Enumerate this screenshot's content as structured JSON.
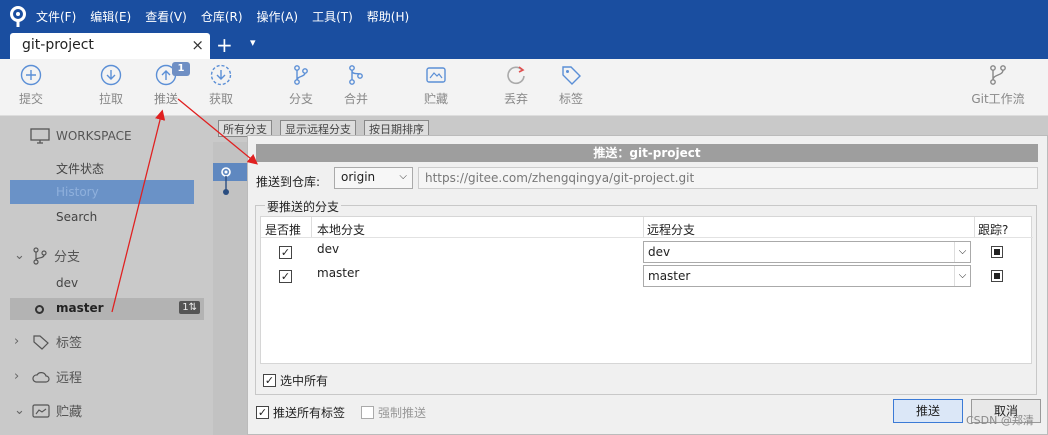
{
  "menu": {
    "items": [
      "文件(F)",
      "编辑(E)",
      "查看(V)",
      "仓库(R)",
      "操作(A)",
      "工具(T)",
      "帮助(H)"
    ]
  },
  "tabs": {
    "active": "git-project",
    "close": "×",
    "add": "+",
    "more": "▾"
  },
  "toolbar": {
    "commit": "提交",
    "pull": "拉取",
    "push": "推送",
    "fetch": "获取",
    "branch": "分支",
    "merge": "合并",
    "stash": "贮藏",
    "discard": "丢弃",
    "tag": "标签",
    "gitflow": "Git工作流",
    "push_badge": "1"
  },
  "sidebar": {
    "workspace": "WORKSPACE",
    "file_status": "文件状态",
    "history": "History",
    "search": "Search",
    "branches": "分支",
    "branch_dev": "dev",
    "branch_master": "master",
    "master_count": "1⇅",
    "tags": "标签",
    "remotes": "远程",
    "stashes": "贮藏"
  },
  "filterbar": {
    "all_branches": "所有分支",
    "show_remote": "显示远程分支",
    "sort": "按日期排序"
  },
  "dialog": {
    "title": "推送：git-project",
    "push_to_repo_label": "推送到仓库:",
    "repo_value": "origin",
    "repo_url": "https://gitee.com/zhengqingya/git-project.git",
    "branches_group": "要推送的分支",
    "columns": [
      "是否推",
      "本地分支",
      "远程分支",
      "跟踪?"
    ],
    "rows": [
      {
        "local": "dev",
        "remote": "dev",
        "push": true,
        "track": true
      },
      {
        "local": "master",
        "remote": "master",
        "push": true,
        "track": true
      }
    ],
    "select_all": "选中所有",
    "push_all_tags": "推送所有标签",
    "force_push": "强制推送",
    "push_button": "推送",
    "cancel_button": "取消"
  },
  "watermark": "CSDN @郑清",
  "colors": {
    "title_bar": "#1a4ea0",
    "selection": "#6a92c7",
    "arrow": "#e02020"
  }
}
